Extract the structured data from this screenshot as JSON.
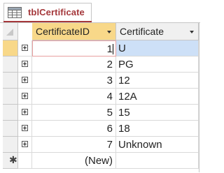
{
  "tab": {
    "title": "tblCertificate",
    "icon": "table-icon"
  },
  "columns": [
    {
      "label": "CertificateID",
      "icon": "dropdown-arrow-icon"
    },
    {
      "label": "Certificate",
      "icon": "dropdown-arrow-icon"
    }
  ],
  "rows": [
    {
      "id": "1",
      "certificate": "U"
    },
    {
      "id": "2",
      "certificate": "PG"
    },
    {
      "id": "3",
      "certificate": "12"
    },
    {
      "id": "4",
      "certificate": "12A"
    },
    {
      "id": "5",
      "certificate": "15"
    },
    {
      "id": "6",
      "certificate": "18"
    },
    {
      "id": "7",
      "certificate": "Unknown"
    }
  ],
  "new_row": {
    "marker": "✱",
    "id_placeholder": "(New)"
  },
  "colors": {
    "accent": "#a4373a",
    "header_active": "#f8d889",
    "selection": "#cde0f7"
  }
}
